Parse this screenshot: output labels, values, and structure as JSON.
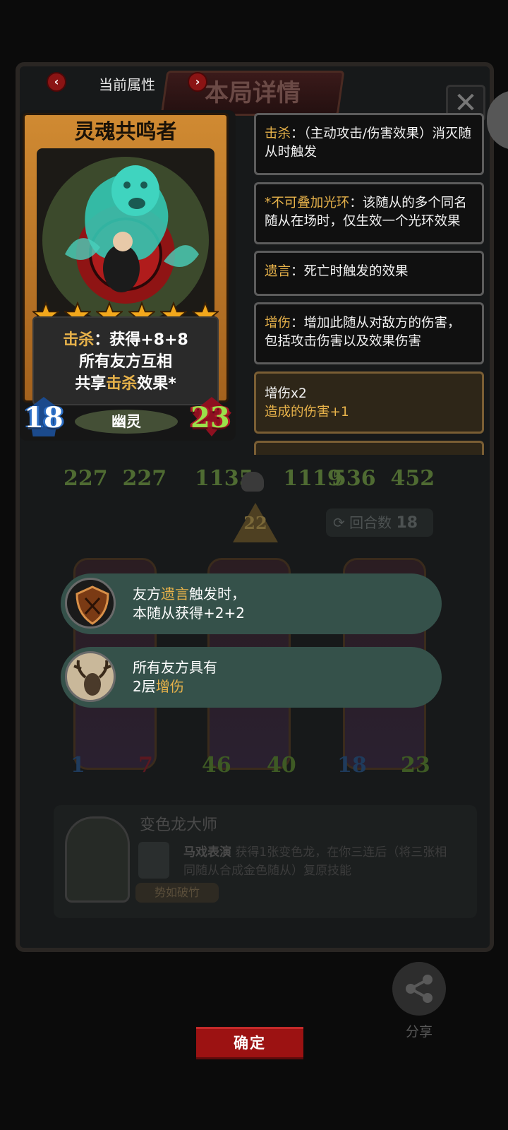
{
  "background": {
    "title": "本局详情",
    "close_icon": "close-icon",
    "stat_pairs": [
      {
        "left": "227",
        "right": "227"
      },
      {
        "left": "1135",
        "right": "1119"
      },
      {
        "left": "536",
        "right": "452"
      }
    ],
    "level": "22",
    "round_label": "回合数",
    "round_value": "18",
    "lower_cards": [
      {
        "atk": "1",
        "hp": "7"
      },
      {
        "atk": "46",
        "hp": "40"
      },
      {
        "atk": "18",
        "hp": "23"
      }
    ],
    "hero": {
      "name": "变色龙大师",
      "skill_name": "马戏表演",
      "skill_desc": "获得1张变色龙，在你三连后（将三张相同随从合成金色随从）复原技能",
      "badge": "势如破竹"
    }
  },
  "tabs": {
    "label": "当前属性",
    "prev_icon": "chevron-left-icon",
    "next_icon": "chevron-right-icon"
  },
  "card": {
    "name": "灵魂共鸣者",
    "stars": 6,
    "text_line1_kw": "击杀",
    "text_line1_rest": "：获得+8+8",
    "text_line2": "所有友方互相",
    "text_line3_pre": "共享",
    "text_line3_kw": "击杀",
    "text_line3_post": "效果*",
    "tribe": "幽灵",
    "attack": "18",
    "health": "23"
  },
  "keywords": [
    {
      "name": "击杀",
      "desc": "：（主动攻击/伤害效果）消灭随从时触发"
    },
    {
      "name": "*不可叠加光环",
      "desc": "：该随从的多个同名随从在场时，仅生效一个光环效果"
    },
    {
      "name": "遗言",
      "desc": "：死亡时触发的效果"
    },
    {
      "name": "增伤",
      "desc": "：增加此随从对敌方的伤害，包括攻击伤害以及效果伤害"
    }
  ],
  "buff": {
    "title": "增伤x2",
    "detail": "造成的伤害+1"
  },
  "triggers": [
    {
      "line1_pre": "友方",
      "line1_kw": "遗言",
      "line1_post": "触发时，",
      "line2": "本随从获得+2+2",
      "icon": "shield-icon"
    },
    {
      "line1_pre": "所有友方具有",
      "line1_kw": "",
      "line1_post": "",
      "line2_pre": "2层",
      "line2_kw": "增伤",
      "icon": "antler-skull-icon"
    }
  ],
  "share": {
    "label": "分享",
    "icon": "share-icon"
  },
  "confirm": {
    "label": "确定"
  },
  "colors": {
    "keyword": "#e7b24a",
    "confirm": "#9c1212",
    "bubble": "#35514a",
    "card_frame": "#d08a32"
  }
}
